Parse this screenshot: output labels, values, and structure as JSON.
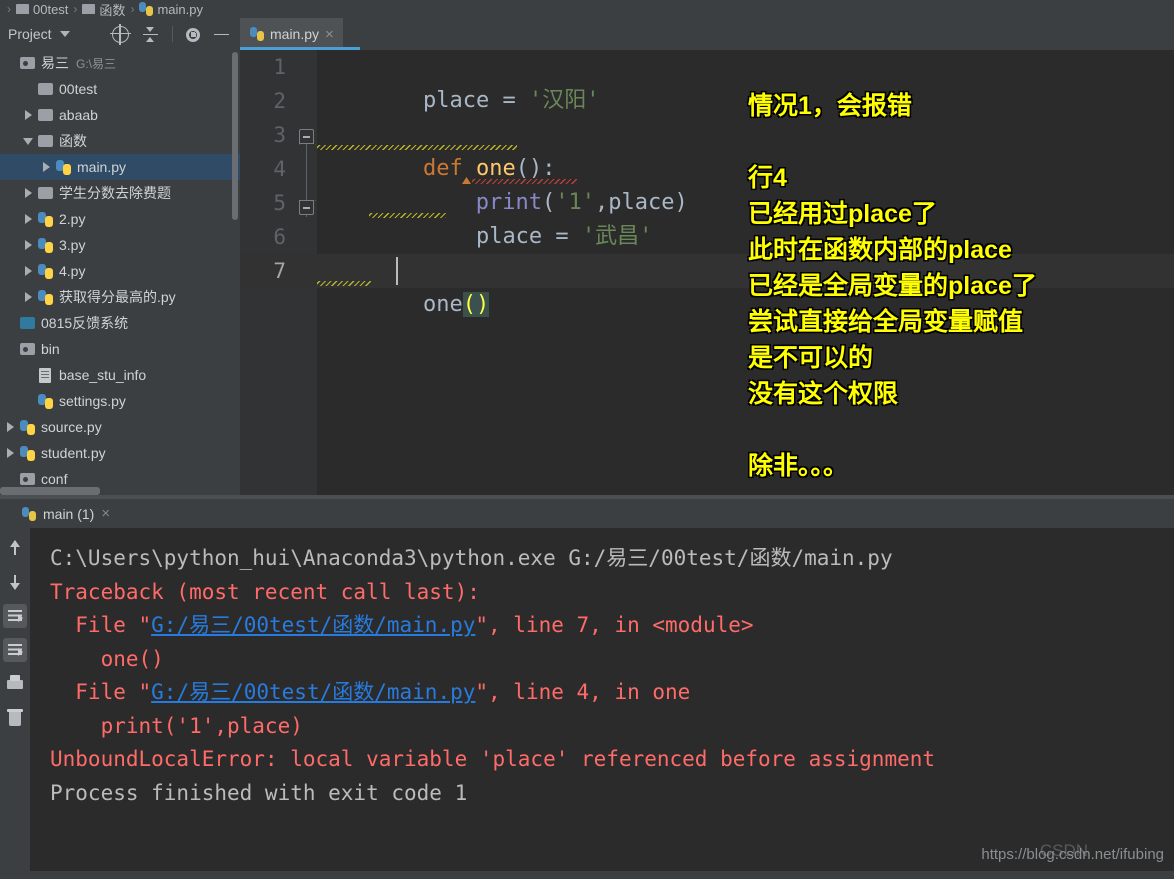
{
  "breadcrumb": {
    "items": [
      {
        "icon": "folder-icon",
        "label": "00test"
      },
      {
        "icon": "folder-icon",
        "label": "函数"
      },
      {
        "icon": "python-file-icon",
        "label": "main.py"
      }
    ],
    "separator": "›"
  },
  "project_panel": {
    "title": "Project",
    "caret": "chevron-down-icon",
    "toolbar": [
      {
        "name": "locate-icon",
        "title": "Select Opened File"
      },
      {
        "name": "collapse-all-icon",
        "title": "Collapse All"
      },
      {
        "name": "gear-icon",
        "title": "Settings"
      },
      {
        "name": "minimize-icon",
        "title": "Hide"
      }
    ],
    "tree": [
      {
        "indent": 0,
        "twisty": "none",
        "icon": "module-folder-icon",
        "label": "易三",
        "path": "G:\\易三"
      },
      {
        "indent": 1,
        "twisty": "none",
        "icon": "folder-icon",
        "label": "00test",
        "path": ""
      },
      {
        "indent": 1,
        "twisty": "right",
        "icon": "folder-icon",
        "label": "abaab",
        "path": ""
      },
      {
        "indent": 1,
        "twisty": "down",
        "icon": "folder-icon",
        "label": "函数",
        "path": ""
      },
      {
        "indent": 2,
        "twisty": "right",
        "icon": "python-file-icon",
        "label": "main.py",
        "path": "",
        "selected": true
      },
      {
        "indent": 1,
        "twisty": "right",
        "icon": "folder-icon",
        "label": "学生分数去除费题",
        "path": ""
      },
      {
        "indent": 1,
        "twisty": "right",
        "icon": "python-file-icon",
        "label": "2.py",
        "path": ""
      },
      {
        "indent": 1,
        "twisty": "right",
        "icon": "python-file-icon",
        "label": "3.py",
        "path": ""
      },
      {
        "indent": 1,
        "twisty": "right",
        "icon": "python-file-icon",
        "label": "4.py",
        "path": ""
      },
      {
        "indent": 1,
        "twisty": "right",
        "icon": "python-file-icon",
        "label": "获取得分最高的.py",
        "path": ""
      },
      {
        "indent": 0,
        "twisty": "none",
        "icon": "blue-folder-icon",
        "label": "0815反馈系统",
        "path": ""
      },
      {
        "indent": 0,
        "twisty": "none",
        "icon": "module-folder-icon",
        "label": "bin",
        "path": ""
      },
      {
        "indent": 1,
        "twisty": "none",
        "icon": "text-file-icon",
        "label": "base_stu_info",
        "path": ""
      },
      {
        "indent": 1,
        "twisty": "none",
        "icon": "python-file-icon",
        "label": "settings.py",
        "path": ""
      },
      {
        "indent": 0,
        "twisty": "right",
        "icon": "python-file-icon",
        "label": "source.py",
        "path": ""
      },
      {
        "indent": 0,
        "twisty": "right",
        "icon": "python-file-icon",
        "label": "student.py",
        "path": ""
      },
      {
        "indent": 0,
        "twisty": "none",
        "icon": "module-folder-icon",
        "label": "conf",
        "path": ""
      }
    ]
  },
  "editor": {
    "tab": {
      "label": "main.py",
      "icon": "python-file-icon",
      "close": "×"
    },
    "line_numbers": [
      "1",
      "2",
      "3",
      "4",
      "5",
      "6",
      "7"
    ],
    "current_line": 7,
    "code": {
      "l1_var": "place",
      "l1_eq": " = ",
      "l1_str": "'汉阳'",
      "l3_def": "def",
      "l3_name": " one",
      "l3_tail": "():",
      "l4_print": "print",
      "l4_open": "(",
      "l4_str": "'1'",
      "l4_comma": ",",
      "l4_var": "place",
      "l4_close": ")",
      "l5_var": "    place",
      "l5_eq": " = ",
      "l5_str": "'武昌'",
      "l7_name": "one",
      "l7_parens": "()"
    }
  },
  "annotation": {
    "lines": [
      "情况1，会报错",
      "",
      "行4",
      "已经用过place了",
      "此时在函数内部的place",
      "已经是全局变量的place了",
      "尝试直接给全局变量赋值",
      "是不可以的",
      "没有这个权限",
      "",
      "除非。。。"
    ],
    "color": "#ffff00"
  },
  "console": {
    "tab": {
      "label": "main (1)",
      "icon": "python-file-icon",
      "close": "×"
    },
    "toolbar": [
      {
        "name": "scroll-up-icon",
        "active": false
      },
      {
        "name": "scroll-down-icon",
        "active": false
      },
      {
        "name": "soft-wrap-icon",
        "active": true
      },
      {
        "name": "scroll-to-end-icon",
        "active": true
      },
      {
        "name": "print-icon",
        "active": false
      },
      {
        "name": "clear-all-icon",
        "active": false
      }
    ],
    "output": [
      {
        "type": "normal",
        "parts": [
          {
            "style": "norm",
            "text": "C:\\Users\\python_hui\\Anaconda3\\python.exe G:/易三/00test/函数/main.py"
          }
        ]
      },
      {
        "type": "error",
        "parts": [
          {
            "style": "err",
            "text": "Traceback (most recent call last):"
          }
        ]
      },
      {
        "type": "error",
        "parts": [
          {
            "style": "err",
            "text": "  File \""
          },
          {
            "style": "link",
            "text": "G:/易三/00test/函数/main.py"
          },
          {
            "style": "err",
            "text": "\", line 7, in <module>"
          }
        ]
      },
      {
        "type": "error",
        "parts": [
          {
            "style": "err",
            "text": "    one()"
          }
        ]
      },
      {
        "type": "error",
        "parts": [
          {
            "style": "err",
            "text": "  File \""
          },
          {
            "style": "link",
            "text": "G:/易三/00test/函数/main.py"
          },
          {
            "style": "err",
            "text": "\", line 4, in one"
          }
        ]
      },
      {
        "type": "error",
        "parts": [
          {
            "style": "err",
            "text": "    print('1',place)"
          }
        ]
      },
      {
        "type": "error",
        "parts": [
          {
            "style": "err",
            "text": "UnboundLocalError: local variable 'place' referenced before assignment"
          }
        ]
      },
      {
        "type": "blank",
        "parts": [
          {
            "style": "norm",
            "text": ""
          }
        ]
      },
      {
        "type": "normal",
        "parts": [
          {
            "style": "norm",
            "text": "Process finished with exit code 1"
          }
        ]
      }
    ]
  },
  "watermark": {
    "text": "https://blog.csdn.net/ifubing",
    "ghost": "CSDN"
  },
  "colors": {
    "accent": "#4a9fd4",
    "editor_bg": "#2b2b2b",
    "panel_bg": "#3c3f41",
    "selection": "#2f4b66",
    "annotation": "#ffff00",
    "error": "#ff6b68",
    "link": "#287bde"
  }
}
